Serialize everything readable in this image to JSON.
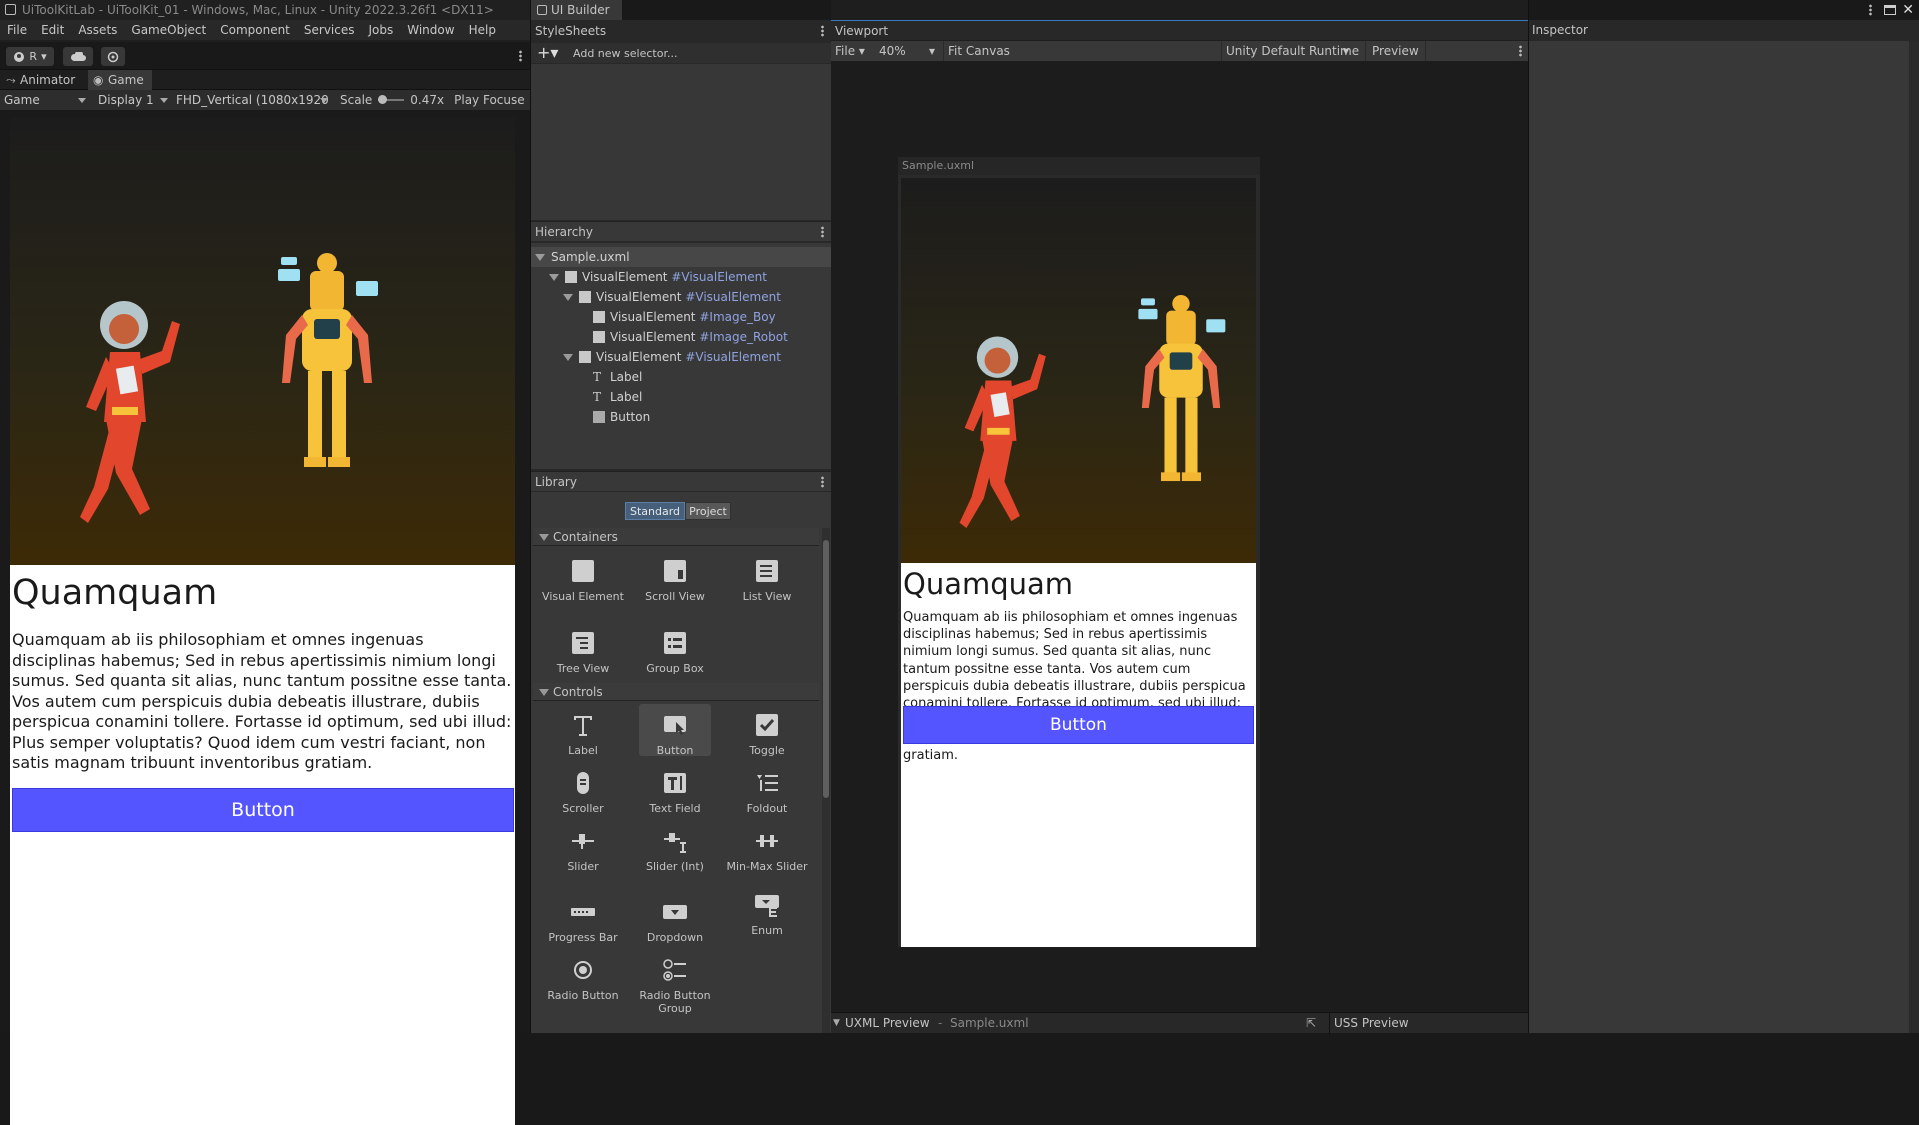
{
  "left_window": {
    "title": "UiToolKitLab - UiToolKit_01 - Windows, Mac, Linux - Unity 2022.3.26f1 <DX11>",
    "menu": [
      "File",
      "Edit",
      "Assets",
      "GameObject",
      "Component",
      "Services",
      "Jobs",
      "Window",
      "Help"
    ],
    "account_label": "R",
    "tabs": {
      "animator": "Animator",
      "game": "Game"
    },
    "gamebar": {
      "mode": "Game",
      "display": "Display 1",
      "resolution": "FHD_Vertical (1080x1920",
      "scale_label": "Scale",
      "scale_value": "0.47x",
      "play_focus": "Play Focuse"
    },
    "content": {
      "heading": "Quamquam",
      "paragraph": "Quamquam ab iis philosophiam et omnes ingenuas disciplinas habemus; Sed in rebus apertissimis nimium longi sumus. Sed quanta sit alias, nunc tantum possitne esse tanta. Vos autem cum perspicuis dubia debeatis illustrare, dubiis perspicua conamini tollere. Fortasse id optimum, sed ubi illud: Plus semper voluptatis? Quod idem cum vestri faciant, non satis magnam tribuunt inventoribus gratiam.",
      "button": "Button"
    }
  },
  "builder": {
    "window_tab": "UI Builder",
    "stylesheets": {
      "title": "StyleSheets",
      "add_selector_placeholder": "Add new selector..."
    },
    "hierarchy": {
      "title": "Hierarchy",
      "root": "Sample.uxml",
      "rows": [
        {
          "type": "VisualElement",
          "name": "#VisualElement"
        },
        {
          "type": "VisualElement",
          "name": "#VisualElement"
        },
        {
          "type": "VisualElement",
          "name": "#Image_Boy"
        },
        {
          "type": "VisualElement",
          "name": "#Image_Robot"
        },
        {
          "type": "VisualElement",
          "name": "#VisualElement"
        },
        {
          "type": "Label",
          "name": ""
        },
        {
          "type": "Label",
          "name": ""
        },
        {
          "type": "Button",
          "name": ""
        }
      ]
    },
    "library": {
      "title": "Library",
      "tab_standard": "Standard",
      "tab_project": "Project",
      "containers_label": "Containers",
      "controls_label": "Controls",
      "containers": [
        "Visual Element",
        "Scroll View",
        "List View",
        "Tree View",
        "Group Box"
      ],
      "controls": [
        "Label",
        "Button",
        "Toggle",
        "Scroller",
        "Text Field",
        "Foldout",
        "Slider",
        "Slider (Int)",
        "Min-Max Slider",
        "Progress Bar",
        "Dropdown",
        "Enum",
        "Radio Button",
        "Radio Button Group"
      ]
    },
    "viewport": {
      "title": "Viewport",
      "file_menu": "File",
      "zoom": "40%",
      "fit_canvas": "Fit Canvas",
      "theme": "Unity Default Runtime ...",
      "preview": "Preview",
      "canvas_title": "Sample.uxml",
      "uxml_preview": "UXML Preview",
      "uxml_file": "Sample.uxml",
      "uss_preview": "USS Preview"
    },
    "inspector": {
      "title": "Inspector"
    }
  },
  "colors": {
    "accent_button": "#5555ff",
    "selector_text": "#8fa3e0"
  }
}
